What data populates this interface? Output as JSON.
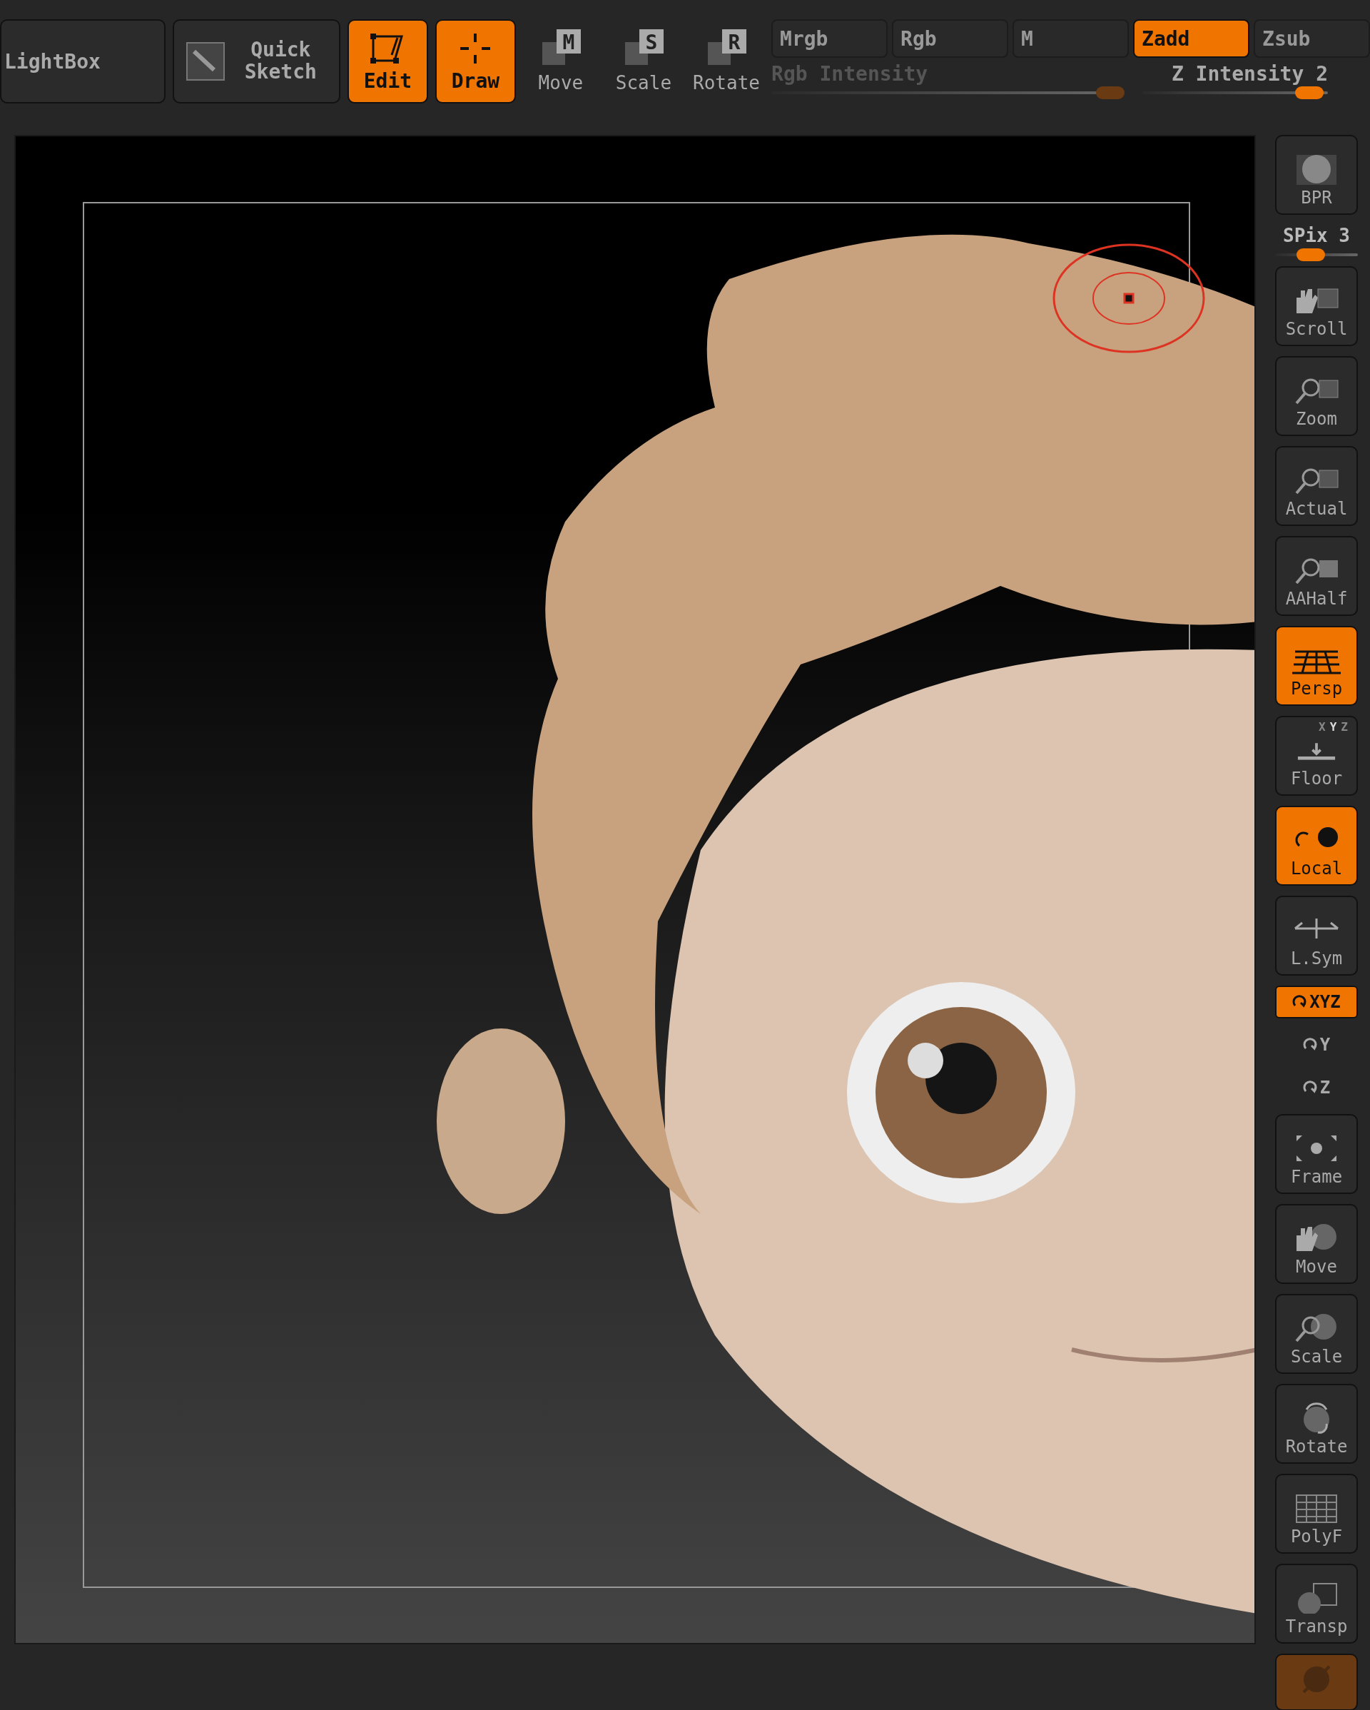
{
  "toolbar": {
    "buttons": [
      {
        "label": "LightBox",
        "kind": "wide",
        "selected": false
      },
      {
        "label": "Quick Sketch",
        "kind": "sketch",
        "selected": false
      },
      {
        "label": "Edit",
        "kind": "mode",
        "selected": true
      },
      {
        "label": "Draw",
        "kind": "mode",
        "selected": true
      },
      {
        "label": "Move",
        "kind": "tool",
        "letter": "M",
        "selected": false
      },
      {
        "label": "Scale",
        "kind": "tool",
        "letter": "S",
        "selected": false
      },
      {
        "label": "Rotate",
        "kind": "tool",
        "letter": "R",
        "selected": false
      }
    ],
    "modes": [
      {
        "label": "Mrgb",
        "selected": false
      },
      {
        "label": "Rgb",
        "selected": false
      },
      {
        "label": "M",
        "selected": false
      },
      {
        "label": "Zadd",
        "selected": true
      },
      {
        "label": "Zsub",
        "selected": false
      }
    ],
    "sliders": [
      {
        "label": "Rgb Intensity",
        "disabled": true,
        "level": 0.99
      },
      {
        "label": "Z Intensity 2",
        "disabled": false,
        "level": 0.9
      }
    ]
  },
  "sidebar": [
    {
      "kind": "button",
      "label": "BPR",
      "selected": false
    },
    {
      "kind": "slider",
      "label": "SPix 3",
      "level": 0.43
    },
    {
      "kind": "button",
      "label": "Scroll",
      "selected": false
    },
    {
      "kind": "button",
      "label": "Zoom",
      "selected": false
    },
    {
      "kind": "button",
      "label": "Actual",
      "selected": false
    },
    {
      "kind": "button",
      "label": "AAHalf",
      "selected": false
    },
    {
      "kind": "button",
      "label": "Persp",
      "selected": true
    },
    {
      "kind": "floor",
      "label": "Floor",
      "selected": false,
      "axes": [
        {
          "label": "X",
          "selected": false
        },
        {
          "label": "Y",
          "selected": true
        },
        {
          "label": "Z",
          "selected": false
        }
      ]
    },
    {
      "kind": "button",
      "label": "Local",
      "selected": true
    },
    {
      "kind": "button",
      "label": "L.Sym",
      "selected": false
    },
    {
      "kind": "axis",
      "label": "XYZ",
      "selected": true
    },
    {
      "kind": "axis",
      "label": "Y",
      "selected": false
    },
    {
      "kind": "axis",
      "label": "Z",
      "selected": false
    },
    {
      "kind": "button",
      "label": "Frame",
      "selected": false
    },
    {
      "kind": "button",
      "label": "Move",
      "selected": false
    },
    {
      "kind": "button",
      "label": "Scale",
      "selected": false
    },
    {
      "kind": "button",
      "label": "Rotate",
      "selected": false
    },
    {
      "kind": "button",
      "label": "PolyF",
      "selected": false
    },
    {
      "kind": "button",
      "label": "Transp",
      "selected": false
    },
    {
      "kind": "blank",
      "selected": true
    }
  ]
}
